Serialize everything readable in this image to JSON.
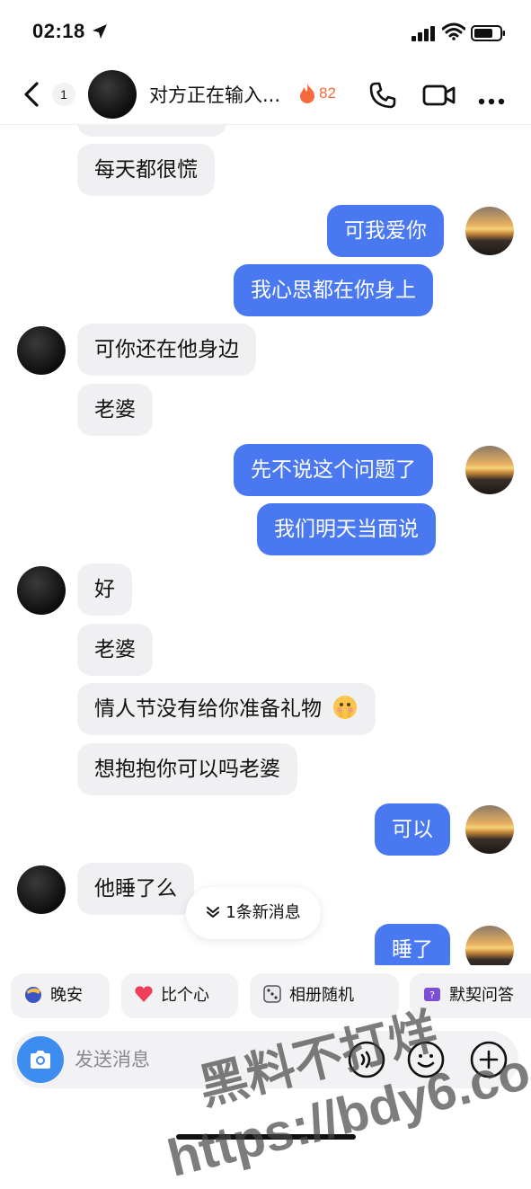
{
  "status_bar": {
    "time": "02:18"
  },
  "header": {
    "unread_count": "1",
    "title": "对方正在输入...",
    "streak_count": "82"
  },
  "messages": [
    {
      "from": "them",
      "text": "每天都很慌"
    },
    {
      "from": "me",
      "text": "可我爱你"
    },
    {
      "from": "me",
      "text": "我心思都在你身上"
    },
    {
      "from": "them",
      "text": "可你还在他身边"
    },
    {
      "from": "them",
      "text": "老婆"
    },
    {
      "from": "me",
      "text": "先不说这个问题了"
    },
    {
      "from": "me",
      "text": "我们明天当面说"
    },
    {
      "from": "them",
      "text": "好"
    },
    {
      "from": "them",
      "text": "老婆"
    },
    {
      "from": "them",
      "text": "情人节没有给你准备礼物"
    },
    {
      "from": "them",
      "text": "想抱抱你可以吗老婆"
    },
    {
      "from": "me",
      "text": "可以"
    },
    {
      "from": "them",
      "text": "他睡了么"
    },
    {
      "from": "me",
      "text": "睡了"
    }
  ],
  "new_message_pill": "1条新消息",
  "quick_replies": [
    "晚安",
    "比个心",
    "相册随机",
    "默契问答"
  ],
  "composer": {
    "placeholder": "发送消息"
  },
  "watermark": {
    "line1": "黑料不打烊",
    "line2": "https://bdy6.co"
  },
  "colors": {
    "outgoing_bubble": "#4a78f0",
    "incoming_bubble": "#f0f0f2",
    "streak": "#f56a3c"
  }
}
